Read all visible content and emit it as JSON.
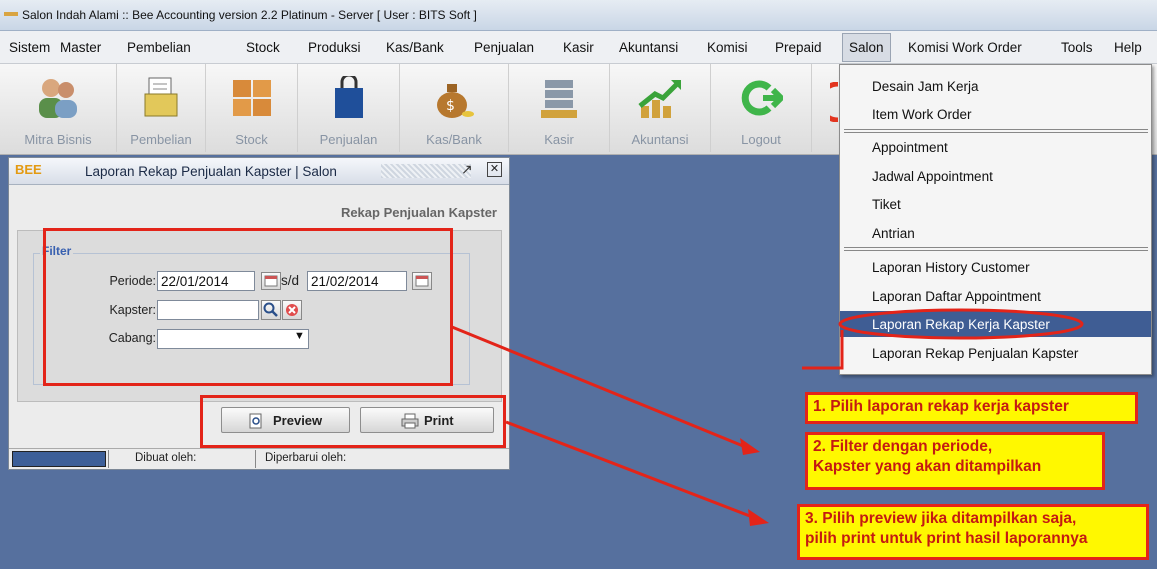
{
  "window_title": "Salon Indah Alami :: Bee Accounting version 2.2 Platinum - Server  [ User : BITS Soft ]",
  "menubar": {
    "items": [
      "Sistem",
      "Master",
      "Pembelian",
      "Stock",
      "Produksi",
      "Kas/Bank",
      "Penjualan",
      "Kasir",
      "Akuntansi",
      "Komisi",
      "Prepaid",
      "Salon",
      "Komisi Work Order",
      "Tools",
      "Help"
    ],
    "active": "Salon"
  },
  "toolbar": {
    "buttons": [
      {
        "label": "Mitra Bisnis",
        "icon": "people-icon"
      },
      {
        "label": "Pembelian",
        "icon": "document-cash-icon"
      },
      {
        "label": "Stock",
        "icon": "boxes-icon"
      },
      {
        "label": "Penjualan",
        "icon": "shopping-bag-icon"
      },
      {
        "label": "Kas/Bank",
        "icon": "money-bag-icon"
      },
      {
        "label": "Kasir",
        "icon": "cash-register-icon"
      },
      {
        "label": "Akuntansi",
        "icon": "growth-chart-icon"
      },
      {
        "label": "Logout",
        "icon": "logout-arrow-icon"
      }
    ]
  },
  "report_window": {
    "title": "Laporan Rekap Penjualan Kapster | Salon",
    "logo": "BEE",
    "subtitle": "Rekap Penjualan Kapster",
    "filter_legend": "Filter",
    "periode_label": "Periode:",
    "date_from": "22/01/2014",
    "sd_label": "s/d",
    "date_to": "21/02/2014",
    "kapster_label": "Kapster:",
    "kapster_value": "",
    "cabang_label": "Cabang:",
    "cabang_value": "",
    "preview_label": "Preview",
    "print_label": "Print",
    "status_created": "Dibuat oleh:",
    "status_updated": "Diperbarui oleh:"
  },
  "salon_menu": {
    "items": [
      "Desain Jam Kerja",
      "Item Work Order",
      "Appointment",
      "Jadwal Appointment",
      "Tiket",
      "Antrian",
      "Laporan History Customer",
      "Laporan Daftar Appointment",
      "Laporan Rekap Kerja Kapster",
      "Laporan Rekap Penjualan Kapster"
    ],
    "highlighted": "Laporan Rekap Kerja Kapster"
  },
  "annotations": {
    "step1": "1. Pilih laporan rekap kerja kapster",
    "step2_line1": "2. Filter dengan periode,",
    "step2_line2": "Kapster yang akan ditampilkan",
    "step3_line1": "3. Pilih preview jika ditampilkan saja,",
    "step3_line2": "pilih print untuk print hasil laporannya"
  },
  "colors": {
    "desktop": "#56709e",
    "highlight": "#3f5d94",
    "annotation_red": "#e32419",
    "annotation_yellow": "#fff800"
  }
}
